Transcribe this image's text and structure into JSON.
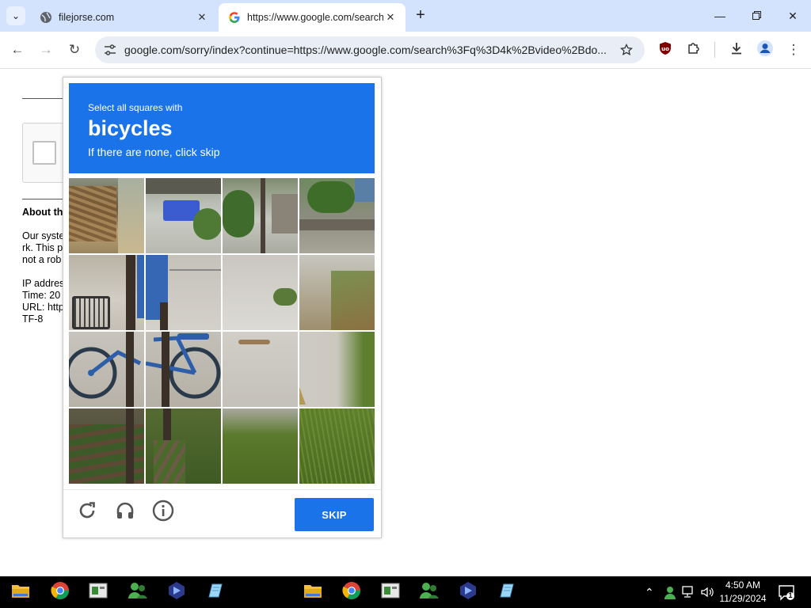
{
  "browser": {
    "tabs": [
      {
        "title": "filejorse.com",
        "active": false
      },
      {
        "title": "https://www.google.com/search",
        "active": true
      }
    ],
    "url": "google.com/sorry/index?continue=https://www.google.com/search%3Fq%3D4k%2Bvideo%2Bdo...",
    "colors": {
      "tabstrip": "#d3e3fd",
      "omnibox": "#e9eef6",
      "ublock": "#800000"
    }
  },
  "page": {
    "about_title": "About th",
    "about_lines": [
      "Our syste",
      "rk. This p",
      "not a rob",
      "",
      "IP addres",
      "Time: 20",
      "URL: http",
      "TF-8"
    ]
  },
  "captcha": {
    "instruction": "Select all squares with",
    "target": "bicycles",
    "hint": "If there are none, click skip",
    "skip_label": "SKIP",
    "accent": "#1a73e8",
    "footer_icons": [
      "reload-icon",
      "headphones-icon",
      "info-icon"
    ]
  },
  "taskbar": {
    "time": "4:50 AM",
    "date": "11/29/2024",
    "notification_count": "1",
    "apps": [
      "file-explorer",
      "chrome",
      "app-window",
      "people",
      "copilot",
      "edit-app",
      "file-explorer",
      "chrome",
      "app-window",
      "people",
      "copilot",
      "edit-app"
    ]
  }
}
